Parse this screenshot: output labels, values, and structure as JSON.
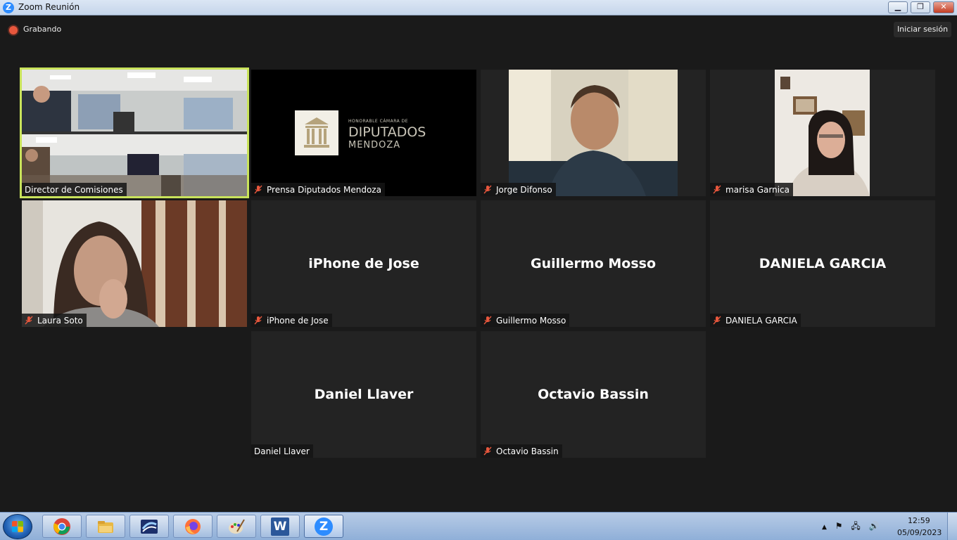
{
  "window": {
    "title": "Zoom Reunión",
    "app_icon": "zoom-logo-icon",
    "app_letter": "Z",
    "min_glyph": "▁",
    "max_glyph": "❐",
    "close_glyph": "✕"
  },
  "meeting": {
    "recording_label": "Grabando",
    "signin_label": "Iniciar sesión"
  },
  "logo": {
    "line1": "HONORABLE CÁMARA DE",
    "line2": "DIPUTADOS",
    "line3": "MENDOZA"
  },
  "participants": [
    {
      "name": "Director de Comisiones",
      "muted": false,
      "video": "room",
      "active": true
    },
    {
      "name": "Prensa Diputados Mendoza",
      "muted": true,
      "video": "logo",
      "active": false
    },
    {
      "name": "Jorge Difonso",
      "muted": true,
      "video": "person-jorge",
      "active": false
    },
    {
      "name": "marisa Garnica",
      "muted": true,
      "video": "person-marisa",
      "active": false
    },
    {
      "name": "Laura Soto",
      "muted": true,
      "video": "person-laura",
      "active": false
    },
    {
      "name": "iPhone de Jose",
      "muted": true,
      "video": "none",
      "active": false
    },
    {
      "name": "Guillermo Mosso",
      "muted": true,
      "video": "none",
      "active": false
    },
    {
      "name": "DANIELA GARCIA",
      "muted": true,
      "video": "none",
      "active": false
    },
    {
      "name": "Daniel Llaver",
      "muted": false,
      "video": "none",
      "active": false
    },
    {
      "name": "Octavio Bassin",
      "muted": true,
      "video": "none",
      "active": false
    }
  ],
  "taskbar": {
    "apps": [
      "chrome-icon",
      "explorer-folder-icon",
      "media-app-icon",
      "firefox-icon",
      "paint-icon",
      "word-icon",
      "zoom-icon"
    ],
    "word_letter": "W",
    "zoom_letter": "Z",
    "tray_up": "▲",
    "tray_flag": "⚑",
    "tray_network": "🖧",
    "tray_volume": "🔊",
    "time": "12:59",
    "date": "05/09/2023"
  },
  "colors": {
    "active_speaker": "#c9e35b",
    "mute_red": "#e8573d",
    "zoom_blue": "#2d8cff"
  }
}
